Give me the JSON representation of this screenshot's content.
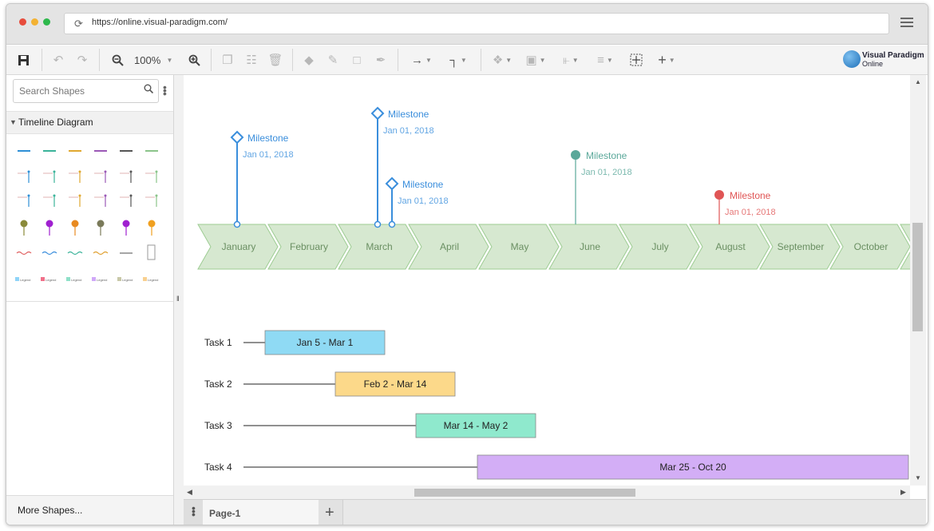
{
  "browser": {
    "url": "https://online.visual-paradigm.com/",
    "dot_colors": [
      "#e74c3c",
      "#f3b233",
      "#2db84b"
    ]
  },
  "toolbar": {
    "zoom": "100%",
    "logo_line1": "Visual Paradigm",
    "logo_line2": "Online"
  },
  "sidebar": {
    "search_placeholder": "Search Shapes",
    "category": "Timeline Diagram",
    "more_shapes": "More Shapes...",
    "legend_label": "Legend",
    "swatch_colors": [
      "#2f8fd6",
      "#3bb39a",
      "#e0a830",
      "#9b59b6",
      "#555555",
      "#8bc48a"
    ]
  },
  "diagram": {
    "months": [
      "January",
      "February",
      "March",
      "April",
      "May",
      "June",
      "July",
      "August",
      "September",
      "October"
    ],
    "milestones": [
      {
        "label": "Milestone",
        "date": "Jan 01, 2018",
        "color": "#3a8edc",
        "marker": "diamond"
      },
      {
        "label": "Milestone",
        "date": "Jan 01, 2018",
        "color": "#3a8edc",
        "marker": "diamond"
      },
      {
        "label": "Milestone",
        "date": "Jan 01, 2018",
        "color": "#3a8edc",
        "marker": "diamond"
      },
      {
        "label": "Milestone",
        "date": "Jan 01, 2018",
        "color": "#5aa89a",
        "marker": "circle"
      },
      {
        "label": "Milestone",
        "date": "Jan 01, 2018",
        "color": "#e05555",
        "marker": "circle"
      }
    ],
    "tasks": [
      {
        "name": "Task 1",
        "range": "Jan 5 - Mar 1",
        "color": "#8fdaf4"
      },
      {
        "name": "Task 2",
        "range": "Feb 2 - Mar 14",
        "color": "#fcd98a"
      },
      {
        "name": "Task 3",
        "range": "Mar 14 - May 2",
        "color": "#8fe9cd"
      },
      {
        "name": "Task 4",
        "range": "Mar 25 - Oct 20",
        "color": "#d3aef6"
      }
    ],
    "chevron_fill": "#d6e8d0",
    "chevron_stroke": "#9dcc92",
    "month_text_color": "#6a8f62"
  },
  "pages": {
    "tab": "Page-1"
  }
}
